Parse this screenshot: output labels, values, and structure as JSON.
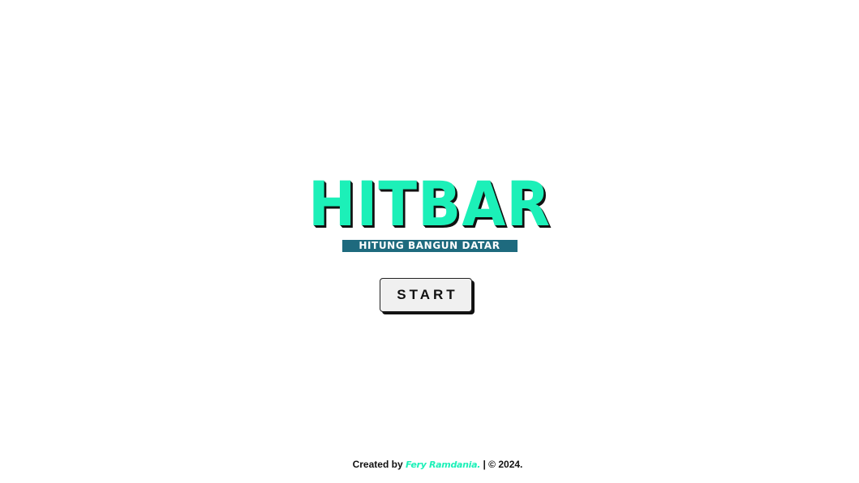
{
  "logo": {
    "title": "HITBAR",
    "subtitle": "HITUNG BANGUN DATAR"
  },
  "start_button": {
    "label": "START"
  },
  "footer": {
    "created_by": "Created by ",
    "author": "Fery Ramdania.",
    "copyright": " | © 2024."
  },
  "colors": {
    "accent": "#1cf0b8",
    "subtitle_bg": "#1e6a7e",
    "background": "#ffffff"
  }
}
